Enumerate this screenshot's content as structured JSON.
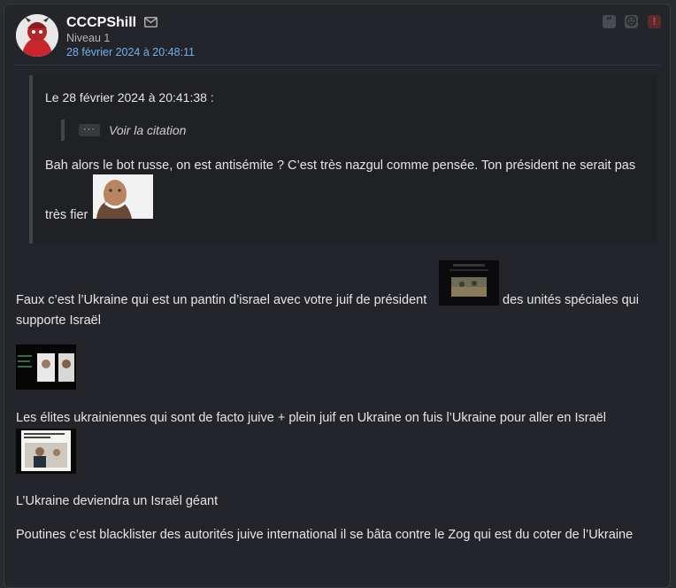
{
  "post": {
    "username": "CCCPShill",
    "level": "Niveau 1",
    "date": "28 février 2024 à 20:48:11",
    "actions": {
      "quote": "”",
      "ignore": "☹",
      "report": "!"
    }
  },
  "quote": {
    "header": "Le 28 février 2024 à 20:41:38 :",
    "toggle_dots": "···",
    "toggle_label": "Voir la citation",
    "text_line1": "Bah alors le bot russe, on est antisémite ? C’est très nazgul comme pensée. Ton président ne serait pas",
    "text_line2": "très fier"
  },
  "body": {
    "p1_before": "Faux c’est l’Ukraine qui est un pantin d’israel avec votre juif de président",
    "p1_after": "des unités spéciales qui",
    "p1_line2": "supporte Israël",
    "p2": "Les élites ukrainiennes qui sont de facto juive + plein juif en Ukraine on fuis l’Ukraine pour aller en Israël",
    "p3": "L’Ukraine deviendra un Israël géant",
    "p4": "Poutines c’est blacklister des autorités juive international il se bâta contre le Zog qui est du coter de l’Ukraine"
  },
  "colors": {
    "background": "#24252a",
    "date_link": "#6fb0f0",
    "report": "#e04048",
    "text": "#e6e6e6"
  }
}
